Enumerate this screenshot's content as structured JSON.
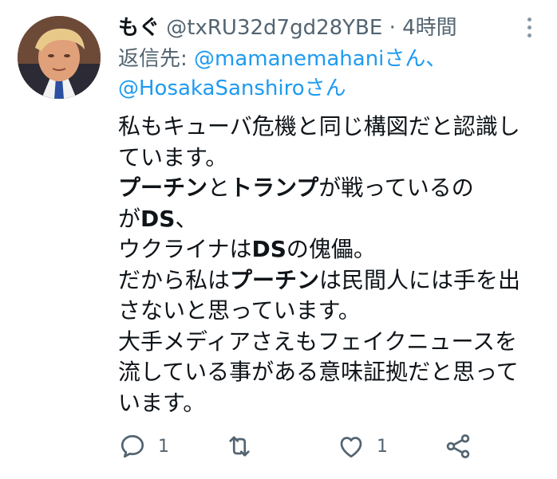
{
  "tweet": {
    "display_name": "もぐ",
    "handle": "@txRU32d7gd28YBE",
    "separator": "·",
    "timestamp": "4時間",
    "reply_prefix": "返信先: ",
    "reply_mention_1": "@mamanemahaniさん、",
    "reply_mention_2": "@HosakaSanshiroさん",
    "body": {
      "l1": "私もキューバ危機と同じ構図だと認識し",
      "l2": "ています。",
      "l3_b1": "プーチン",
      "l3_t1": "と",
      "l3_b2": "トランプ",
      "l3_t2": "が戦っているの",
      "l4_t1": "が",
      "l4_b1": "DS",
      "l4_t2": "、",
      "l5_t1": "ウクライナは",
      "l5_b1": "DS",
      "l5_t2": "の傀儡。",
      "l6_t1": "だから私は",
      "l6_b1": "プーチン",
      "l6_t2": "は民間人には手を出",
      "l7": "さないと思っています。",
      "l8": "大手メディアさえもフェイクニュースを",
      "l9": "流している事がある意味証拠だと思って",
      "l10": "います。"
    },
    "actions": {
      "reply_count": "1",
      "retweet_count": "",
      "like_count": "1"
    }
  },
  "colors": {
    "text": "#0f1419",
    "secondary": "#536471",
    "link": "#1d9bf0"
  },
  "icons": [
    "avatar",
    "more-icon",
    "reply-icon",
    "retweet-icon",
    "like-icon",
    "share-icon"
  ]
}
